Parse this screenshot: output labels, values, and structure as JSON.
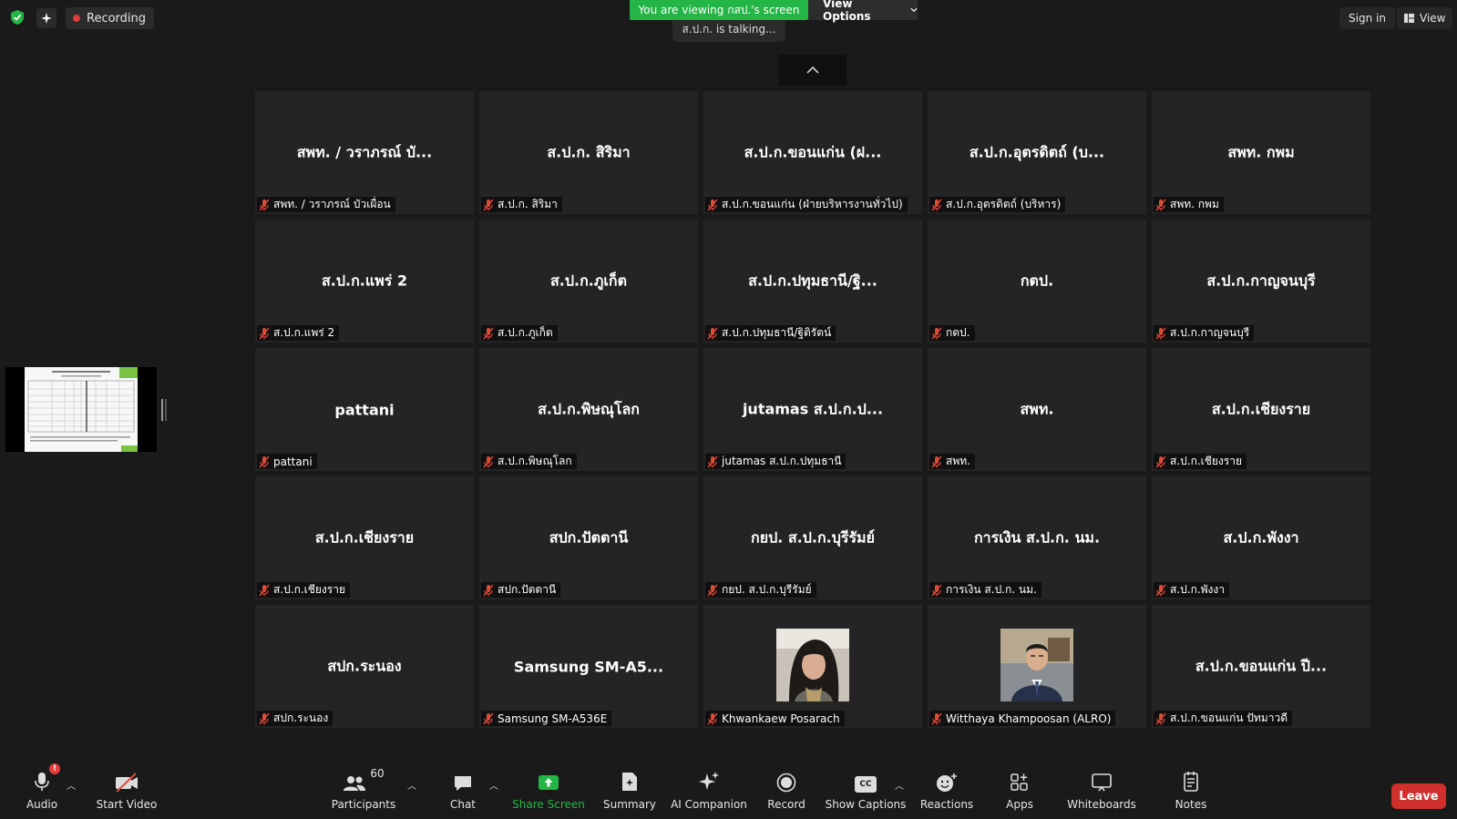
{
  "topbar": {
    "recording_label": "Recording",
    "viewing_text": "You are viewing กสป.'s screen",
    "view_options_label": "View Options",
    "talking_text": "ส.ป.ก. is talking...",
    "sign_in_label": "Sign in",
    "view_label": "View"
  },
  "tiles": [
    {
      "big": "สพท. / วราภรณ์ บั...",
      "label": "สพท. / วราภรณ์ บัวเผื่อน"
    },
    {
      "big": "ส.ป.ก. สิริมา",
      "label": "ส.ป.ก. สิริมา"
    },
    {
      "big": "ส.ป.ก.ขอนแก่น (ฝ...",
      "label": "ส.ป.ก.ขอนแก่น (ฝ่ายบริหารงานทั่วไป)"
    },
    {
      "big": "ส.ป.ก.อุตรดิตถ์ (บ...",
      "label": "ส.ป.ก.อุตรดิตถ์ (บริหาร)"
    },
    {
      "big": "สพท. กพม",
      "label": "สพท. กพม"
    },
    {
      "big": "ส.ป.ก.แพร่ 2",
      "label": "ส.ป.ก.แพร่ 2"
    },
    {
      "big": "ส.ป.ก.ภูเก็ต",
      "label": "ส.ป.ก.ภูเก็ต"
    },
    {
      "big": "ส.ป.ก.ปทุมธานี/ฐิ...",
      "label": "ส.ป.ก.ปทุมธานี/ฐิติรัตน์"
    },
    {
      "big": "กตป.",
      "label": "กตป."
    },
    {
      "big": "ส.ป.ก.กาญจนบุรี",
      "label": "ส.ป.ก.กาญจนบุรี"
    },
    {
      "big": "pattani",
      "label": "pattani"
    },
    {
      "big": "ส.ป.ก.พิษณุโลก",
      "label": "ส.ป.ก.พิษณุโลก"
    },
    {
      "big": "jutamas ส.ป.ก.ป...",
      "label": "jutamas ส.ป.ก.ปทุมธานี"
    },
    {
      "big": "สพท.",
      "label": "สพท."
    },
    {
      "big": "ส.ป.ก.เชียงราย",
      "label": "ส.ป.ก.เชียงราย"
    },
    {
      "big": "ส.ป.ก.เชียงราย",
      "label": "ส.ป.ก.เชียงราย"
    },
    {
      "big": "สปก.ปัตตานี",
      "label": "สปก.ปัตตานี"
    },
    {
      "big": "กยป. ส.ป.ก.บุรีรัมย์",
      "label": "กยป. ส.ป.ก.บุรีรัมย์"
    },
    {
      "big": "การเงิน ส.ป.ก. นม.",
      "label": "การเงิน ส.ป.ก. นม."
    },
    {
      "big": "ส.ป.ก.พังงา",
      "label": "ส.ป.ก.พังงา"
    },
    {
      "big": "สปก.ระนอง",
      "label": "สปก.ระนอง"
    },
    {
      "big": "Samsung SM-A5...",
      "label": "Samsung SM-A536E"
    },
    {
      "big": "",
      "label": "Khwankaew Posarach",
      "photo": "woman"
    },
    {
      "big": "",
      "label": "Witthaya Khampoosan (ALRO)",
      "photo": "man"
    },
    {
      "big": "ส.ป.ก.ขอนแก่น ปี...",
      "label": "ส.ป.ก.ขอนแก่น ปัทมาวดี"
    }
  ],
  "toolbar": {
    "audio_label": "Audio",
    "audio_alert": "!",
    "start_video_label": "Start Video",
    "participants_label": "Participants",
    "participants_count": "60",
    "chat_label": "Chat",
    "share_screen_label": "Share Screen",
    "summary_label": "Summary",
    "ai_companion_label": "AI Companion",
    "record_label": "Record",
    "show_captions_label": "Show Captions",
    "captions_badge": "CC",
    "reactions_label": "Reactions",
    "apps_label": "Apps",
    "whiteboards_label": "Whiteboards",
    "notes_label": "Notes",
    "leave_label": "Leave"
  },
  "colors": {
    "share_green": "#23b545",
    "leave_red": "#d0302c",
    "muted_red": "#e0483b"
  }
}
